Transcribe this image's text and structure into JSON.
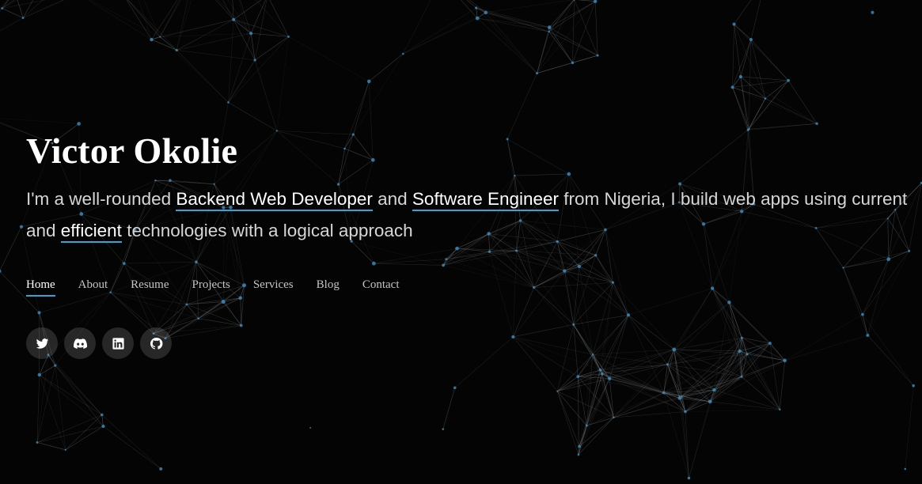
{
  "hero": {
    "name": "Victor Okolie",
    "tagline": {
      "prefix": "I'm a well-rounded ",
      "hl1": "Backend Web Developer",
      "mid1": " and ",
      "hl2": "Software Engineer",
      "mid2": " from Nigeria, I build web apps using current and ",
      "hl3": "efficient",
      "suffix": " technologies with a logical approach"
    }
  },
  "nav": {
    "items": [
      {
        "label": "Home",
        "active": true
      },
      {
        "label": "About"
      },
      {
        "label": "Resume"
      },
      {
        "label": "Projects"
      },
      {
        "label": "Services"
      },
      {
        "label": "Blog"
      },
      {
        "label": "Contact"
      }
    ]
  },
  "social": {
    "icons": [
      "twitter-icon",
      "discord-icon",
      "linkedin-icon",
      "github-icon"
    ]
  },
  "colors": {
    "background": "#040404",
    "accent": "#34a3d6",
    "text": "#d6d6d6"
  }
}
